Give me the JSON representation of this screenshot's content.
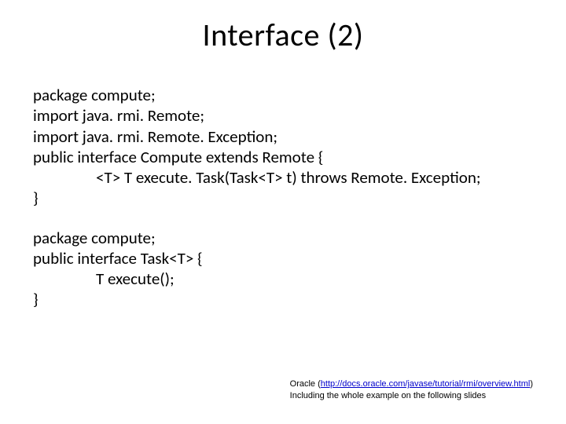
{
  "title": "Interface (2)",
  "code": {
    "block1": {
      "l1": "package compute;",
      "l2": "import java. rmi. Remote;",
      "l3": "import java. rmi. Remote. Exception;",
      "l4": "public interface Compute extends Remote {",
      "l5": "<T> T execute. Task(Task<T> t) throws Remote. Exception;",
      "l6": "}"
    },
    "block2": {
      "l1": "package compute;",
      "l2": "public interface Task<T> {",
      "l3": "T execute();",
      "l4": "}"
    }
  },
  "footer": {
    "source_prefix": "Oracle (",
    "source_url_text": "http://docs.oracle.com/javase/tutorial/rmi/overview.html",
    "source_suffix": ")",
    "note": "Including the whole example on the following slides"
  }
}
